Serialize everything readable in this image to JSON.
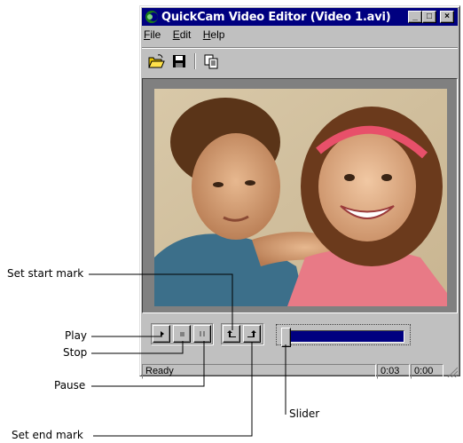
{
  "window": {
    "title": "QuickCam Video Editor (Video 1.avi)",
    "controls": {
      "minimize": "_",
      "maximize": "□",
      "close": "×"
    }
  },
  "menu": {
    "file": {
      "accel": "F",
      "rest": "ile"
    },
    "edit": {
      "accel": "E",
      "rest": "dit"
    },
    "help": {
      "accel": "H",
      "rest": "elp"
    }
  },
  "toolbar": {
    "icons": [
      "open-folder-icon",
      "save-disk-icon",
      "copy-icon"
    ]
  },
  "video": {
    "frame": "photo of a boy and a girl"
  },
  "playback": {
    "icons": [
      "play-icon",
      "stop-icon",
      "pause-icon",
      "set-start-mark-icon",
      "set-end-mark-icon"
    ],
    "slider_position": 0.0
  },
  "status": {
    "text": "Ready",
    "position": "0:03",
    "duration": "0:00"
  },
  "callouts": {
    "set_start_mark": "Set start mark",
    "play": "Play",
    "stop": "Stop",
    "pause": "Pause",
    "set_end_mark": "Set end mark",
    "slider": "Slider"
  },
  "colors": {
    "titlebar": "#000080",
    "window_face": "#c0c0c0",
    "slider_track": "#000080"
  }
}
